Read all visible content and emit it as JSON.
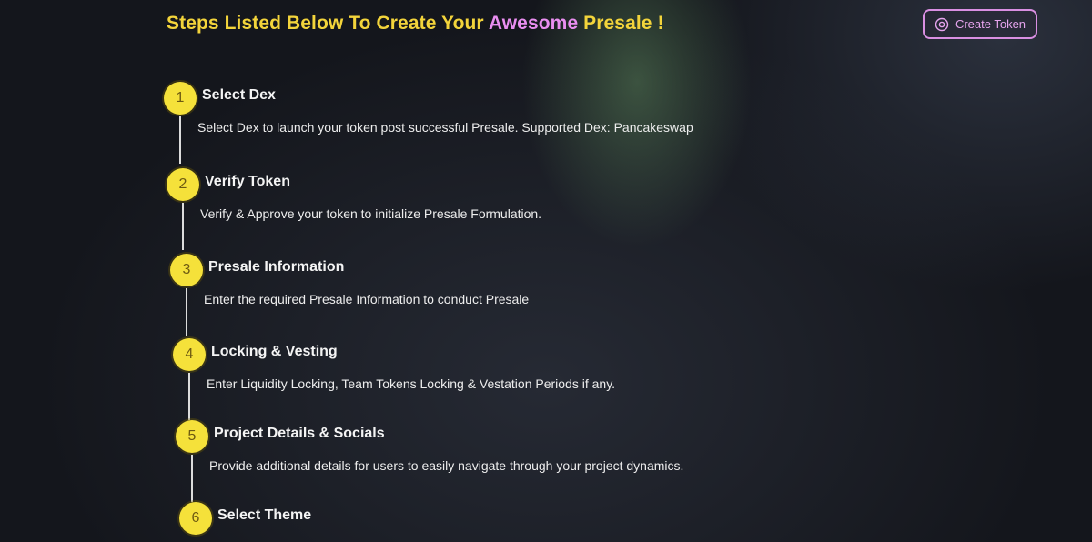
{
  "heading": {
    "prefix": "Steps Listed Below To Create Your ",
    "accent": "Awesome",
    "suffix": " Presale !"
  },
  "create_token_button": {
    "label": "Create Token",
    "icon": "gear-icon"
  },
  "colors": {
    "heading_yellow": "#f3d43b",
    "heading_accent_pink": "#e98ef0",
    "button_border": "#d98fe2",
    "step_circle": "#f5e13a"
  },
  "steps": [
    {
      "number": "1",
      "title": "Select Dex",
      "description": "Select Dex to launch your token post successful Presale. Supported Dex: Pancakeswap"
    },
    {
      "number": "2",
      "title": "Verify Token",
      "description": "Verify & Approve your token to initialize Presale Formulation."
    },
    {
      "number": "3",
      "title": "Presale Information",
      "description": "Enter the required Presale Information to conduct Presale"
    },
    {
      "number": "4",
      "title": "Locking & Vesting",
      "description": "Enter Liquidity Locking, Team Tokens Locking & Vestation Periods if any."
    },
    {
      "number": "5",
      "title": "Project Details & Socials",
      "description": "Provide additional details for users to easily navigate through your project dynamics."
    },
    {
      "number": "6",
      "title": "Select Theme",
      "description": ""
    }
  ]
}
